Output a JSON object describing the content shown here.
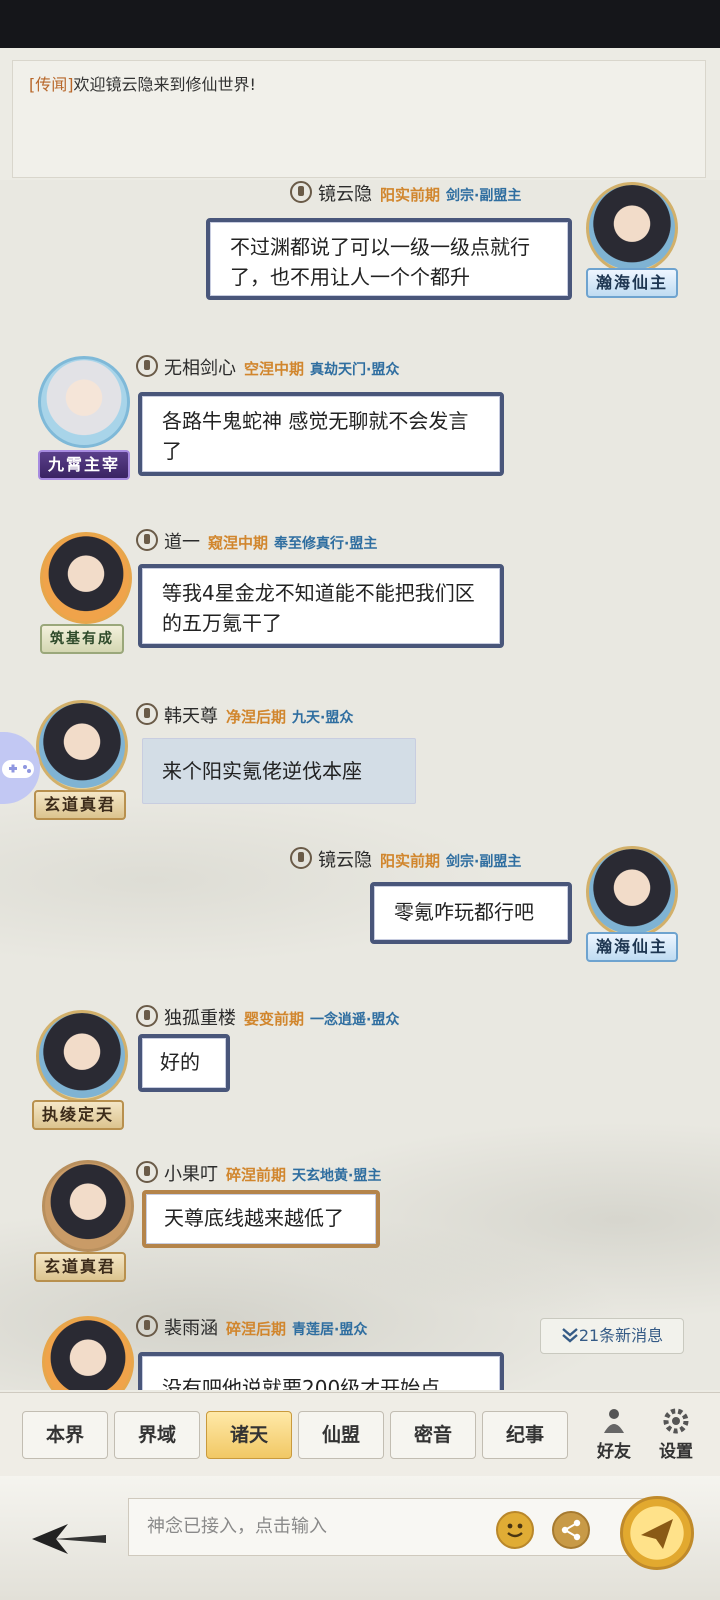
{
  "rumor": {
    "tag": "[传闻]",
    "text": "欢迎镜云隐来到修仙世界!"
  },
  "messages": [
    {
      "name": "镜云隐",
      "realm": "阳实前期",
      "sect": "剑宗·副盟主",
      "title": "瀚海仙主",
      "text": "不过渊都说了可以一级一级点就行了，也不用让人一个个都升"
    },
    {
      "name": "无相剑心",
      "realm": "空涅中期",
      "sect": "真劫天门·盟众",
      "title": "九霄主宰",
      "text": "各路牛鬼蛇神 感觉无聊就不会发言了"
    },
    {
      "name": "道一",
      "realm": "窥涅中期",
      "sect": "奉至修真行·盟主",
      "title": "筑基有成",
      "text": "等我4星金龙不知道能不能把我们区的五万氪干了"
    },
    {
      "name": "韩天尊",
      "realm": "净涅后期",
      "sect": "九天·盟众",
      "title": "玄道真君",
      "text": "来个阳实氪佬逆伐本座"
    },
    {
      "name": "镜云隐",
      "realm": "阳实前期",
      "sect": "剑宗·副盟主",
      "title": "瀚海仙主",
      "text": "零氪咋玩都行吧"
    },
    {
      "name": "独孤重楼",
      "realm": "婴变前期",
      "sect": "一念逍遥·盟众",
      "title": "执绫定天",
      "text": "好的"
    },
    {
      "name": "小果叮",
      "realm": "碎涅前期",
      "sect": "天玄地黄·盟主",
      "title": "玄道真君",
      "text": "天尊底线越来越低了"
    },
    {
      "name": "裴雨涵",
      "realm": "碎涅后期",
      "sect": "青莲居·盟众",
      "text": "没有吧他说就要200级才开始点"
    }
  ],
  "new_messages": "21条新消息",
  "tabs": [
    "本界",
    "界域",
    "诸天",
    "仙盟",
    "密音",
    "纪事"
  ],
  "active_tab": "诸天",
  "side": {
    "friends": "好友",
    "settings": "设置"
  },
  "input": {
    "placeholder": "神念已接入，点击输入"
  },
  "icons": {
    "back": "back-arrow-icon",
    "emoji": "emoji-icon",
    "share": "share-icon",
    "send": "send-icon",
    "speaker": "speaker-icon",
    "friends": "friends-icon",
    "settings": "gear-icon",
    "chevron": "chevron-down-icon"
  },
  "colors": {
    "accent": "#f1c865",
    "realm": "#d1862d",
    "sect": "#2f6ea0",
    "bubble_border": "#49567a"
  }
}
